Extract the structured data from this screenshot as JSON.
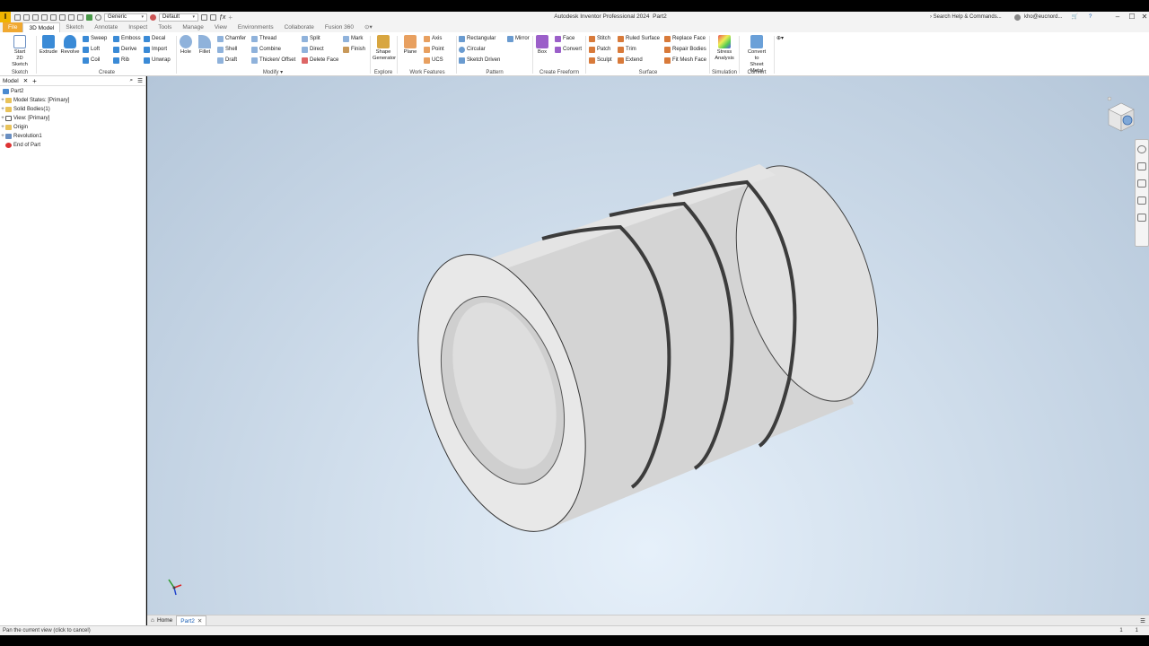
{
  "app": {
    "title": "Autodesk Inventor Professional 2024",
    "document": "Part2",
    "logo_letter": "I",
    "material": "Generic",
    "appearance": "Default",
    "search_placeholder": "Search Help & Commands...",
    "user": "kho@eucnord...",
    "colors": {
      "accent": "#f0a830",
      "viewport_top": "#b4c6d9",
      "viewport_bottom": "#e6f0fa"
    }
  },
  "tabs": [
    "File",
    "3D Model",
    "Sketch",
    "Annotate",
    "Inspect",
    "Tools",
    "Manage",
    "View",
    "Environments",
    "Collaborate",
    "Fusion 360"
  ],
  "active_tab": "3D Model",
  "ribbon": {
    "sketch": {
      "label": "Sketch",
      "start_line1": "Start",
      "start_line2": "2D Sketch"
    },
    "create": {
      "label": "Create",
      "extrude": "Extrude",
      "revolve": "Revolve",
      "sweep": "Sweep",
      "loft": "Loft",
      "coil": "Coil",
      "emboss": "Emboss",
      "derive": "Derive",
      "rib": "Rib",
      "decal": "Decal",
      "import": "Import",
      "unwrap": "Unwrap"
    },
    "modify": {
      "label": "Modify",
      "hole": "Hole",
      "fillet": "Fillet",
      "chamfer": "Chamfer",
      "shell": "Shell",
      "draft": "Draft",
      "thread": "Thread",
      "combine": "Combine",
      "thicken": "Thicken/ Offset",
      "split": "Split",
      "direct": "Direct",
      "delete_face": "Delete Face",
      "mark": "Mark",
      "finish": "Finish"
    },
    "explore": {
      "label": "Explore",
      "shape_line1": "Shape",
      "shape_line2": "Generator"
    },
    "work_features": {
      "label": "Work Features",
      "plane": "Plane",
      "axis": "Axis",
      "point": "Point",
      "ucs": "UCS"
    },
    "pattern": {
      "label": "Pattern",
      "rectangular": "Rectangular",
      "circular": "Circular",
      "sketch_driven": "Sketch Driven",
      "mirror": "Mirror"
    },
    "freeform": {
      "label": "Create Freeform",
      "box": "Box",
      "face": "Face",
      "convert": "Convert"
    },
    "surface": {
      "label": "Surface",
      "stitch": "Stitch",
      "patch": "Patch",
      "sculpt": "Sculpt",
      "ruled_surface": "Ruled Surface",
      "trim": "Trim",
      "extend": "Extend",
      "replace_face": "Replace Face",
      "repair_bodies": "Repair Bodies",
      "fit_mesh_face": "Fit Mesh Face"
    },
    "simulation": {
      "label": "Simulation",
      "stress_line1": "Stress",
      "stress_line2": "Analysis"
    },
    "convert": {
      "label": "Convert",
      "sheet_line1": "Convert to",
      "sheet_line2": "Sheet Metal"
    }
  },
  "browser": {
    "tab_label": "Model",
    "root": "Part2",
    "items": [
      "Model States: [Primary]",
      "Solid Bodies(1)",
      "View: [Primary]",
      "Origin",
      "Revolution1",
      "End of Part"
    ]
  },
  "doc_tabs": {
    "home": "Home",
    "part": "Part2"
  },
  "status": {
    "message": "Pan the current view (click to cancel)",
    "count1": "1",
    "count2": "1"
  }
}
